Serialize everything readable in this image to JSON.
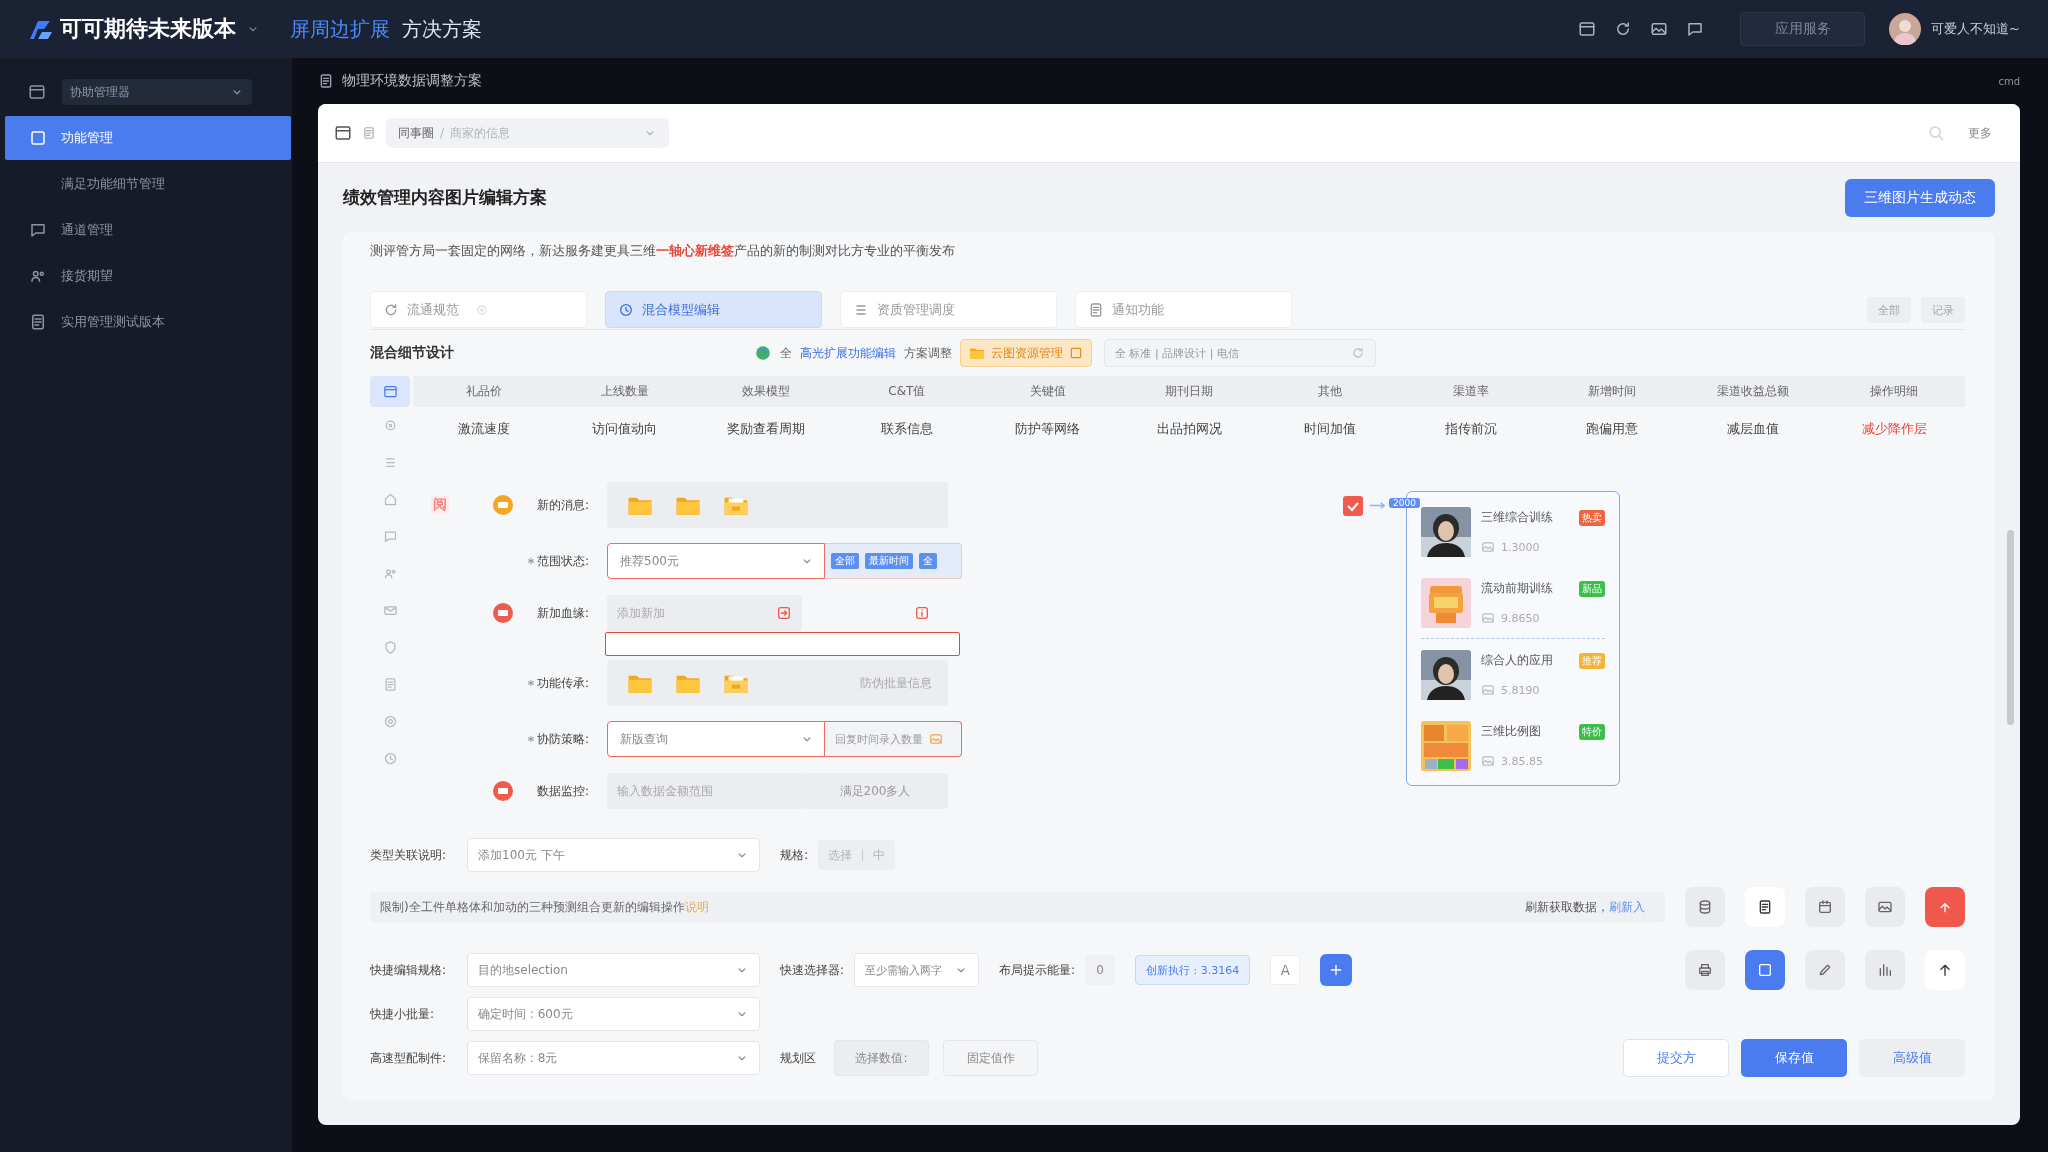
{
  "topbar": {
    "app_name": "可可期待未来版本",
    "nav": [
      {
        "label": "屏周边扩展",
        "selected": true
      },
      {
        "label": "方决方案",
        "selected": false
      }
    ],
    "service_button": "应用服务",
    "user_name": "可爱人不知道~"
  },
  "sidebar": {
    "selector": "协助管理器",
    "items": [
      {
        "kind": "item",
        "label": "功能管理",
        "selected": true
      },
      {
        "kind": "sub",
        "label": "满足功能细节管理",
        "selected": false
      },
      {
        "kind": "item",
        "label": "通道管理",
        "selected": false
      },
      {
        "kind": "item",
        "label": "接货期望",
        "selected": false
      },
      {
        "kind": "item",
        "label": "实用管理测试版本",
        "selected": false
      }
    ]
  },
  "page": {
    "heading": "物理环境数据调整方案",
    "corner_text": "cmd"
  },
  "card": {
    "breadcrumb": {
      "items": [
        "同事圈",
        "商家的信息"
      ],
      "separator": "/"
    },
    "more": "更多",
    "title": "绩效管理内容图片编辑方案",
    "primary_button": "三维图片生成动态"
  },
  "panel": {
    "intro": [
      {
        "text": "测评管方局一套固定的网络，新达服务建更具三维",
        "highlight": false
      },
      {
        "text": "一轴心新维签",
        "highlight": true
      },
      {
        "text": "产品的新的制测对比方专业的平衡发布",
        "highlight": false
      }
    ],
    "tabs": [
      {
        "label": "流通规范",
        "selected": false
      },
      {
        "label": "混合模型编辑",
        "selected": true
      },
      {
        "label": "资质管理调度",
        "selected": false
      },
      {
        "label": "通知功能",
        "selected": false
      }
    ],
    "tab_actions": [
      "全部",
      "记录"
    ],
    "section_title": "混合细节设计",
    "section_tools": [
      {
        "kind": "status",
        "label": "全"
      },
      {
        "kind": "link",
        "label": "高光扩展功能编辑"
      },
      {
        "kind": "text",
        "label": "方案调整"
      },
      {
        "kind": "chip",
        "label": "云图资源管理"
      }
    ],
    "filter": "全 标准 | 品牌设计 | 电信",
    "rail": [
      {
        "selected": true
      },
      {
        "selected": false
      },
      {
        "selected": false
      },
      {
        "selected": false
      },
      {
        "selected": false
      },
      {
        "selected": false
      },
      {
        "selected": false
      },
      {
        "selected": false
      },
      {
        "selected": false
      },
      {
        "selected": false
      },
      {
        "selected": false
      }
    ],
    "table": {
      "columns": [
        "礼品价",
        "上线数量",
        "效果模型",
        "C&T值",
        "关键值",
        "期刊日期",
        "其他",
        "渠道率",
        "新增时间",
        "渠道收益总额",
        "操作明细"
      ],
      "rows": [
        {
          "cells": [
            {
              "text": "激流速度",
              "alert": false
            },
            {
              "text": "访问值动向",
              "alert": false
            },
            {
              "text": "奖励查看周期",
              "alert": false
            },
            {
              "text": "联系信息",
              "alert": false
            },
            {
              "text": "防护等网络",
              "alert": false
            },
            {
              "text": "出品拍网况",
              "alert": false
            },
            {
              "text": "时间加值",
              "alert": false
            },
            {
              "text": "指传前沉",
              "alert": false
            },
            {
              "text": "跑偏用意",
              "alert": false
            },
            {
              "text": "减层血值",
              "alert": false
            },
            {
              "text": "减少降作层",
              "alert": true
            }
          ]
        }
      ]
    }
  },
  "form": {
    "rows": [
      {
        "kind": "folders",
        "label": "新的消息:",
        "required": false,
        "color": "#f5a623",
        "stamp": "阅",
        "folders": [
          {
            "kind": "folder"
          },
          {
            "kind": "folder"
          },
          {
            "kind": "file"
          }
        ]
      },
      {
        "kind": "select",
        "label": "范围状态:",
        "required": true,
        "invalid": true,
        "value": "推荐500元",
        "chips": [
          "全部",
          "最新时间",
          "全"
        ]
      },
      {
        "kind": "input",
        "label": "新加血缘:",
        "required": false,
        "color": "#ef5b4c",
        "placeholder": "添加新加",
        "error_field": true
      },
      {
        "kind": "folders",
        "label": "功能传承:",
        "required": true,
        "folders": [
          {
            "kind": "folder"
          },
          {
            "kind": "folder"
          },
          {
            "kind": "file"
          }
        ],
        "note": "防伪批量信息"
      },
      {
        "kind": "select",
        "label": "协防策略:",
        "required": true,
        "invalid": true,
        "value": "新版查询",
        "suffix": "回复时间录入数量"
      },
      {
        "kind": "input",
        "label": "数据监控:",
        "required": false,
        "color": "#ef5b4c",
        "placeholder": "输入数据金额范围",
        "suffix": "满足200多人"
      }
    ]
  },
  "product_list": {
    "checked": true,
    "tag": "2000",
    "groups": [
      {
        "items": [
          {
            "title": "三维综合训练",
            "badge": "热卖",
            "color": "#f0653f",
            "price": "1.3000"
          },
          {
            "title": "流动前期训练",
            "badge": "新品",
            "color": "#3cbf4a",
            "price": "9.8650"
          }
        ]
      },
      {
        "items": [
          {
            "title": "综合人的应用",
            "badge": "推荐",
            "color": "#f5b335",
            "price": "5.8190"
          },
          {
            "title": "三维比例图",
            "badge": "特价",
            "color": "#3cbf4a",
            "price": "3.85.85"
          }
        ]
      }
    ]
  },
  "bottom": {
    "type_select": {
      "label": "类型关联说明:",
      "value": "添加100元 下午"
    },
    "spec": {
      "label": "规格:",
      "options": [
        "选择",
        "中"
      ]
    },
    "notice": {
      "text": [
        {
          "text": "限制)全工件单格体和加动的三种预测组合更新的编辑操作",
          "highlight": false
        },
        {
          "text": "说明",
          "highlight": true
        }
      ],
      "link_text": [
        {
          "text": "刷新获取数据，",
          "highlight": false
        },
        {
          "text": "刷新入",
          "highlight": true
        }
      ]
    },
    "toolbars": [
      {
        "buttons": [
          {
            "kind": "plain"
          },
          {
            "kind": "light"
          },
          {
            "kind": "plain"
          },
          {
            "kind": "plain"
          },
          {
            "kind": "danger"
          }
        ]
      },
      {
        "buttons": [
          {
            "kind": "plain"
          },
          {
            "kind": "primary"
          },
          {
            "kind": "plain"
          },
          {
            "kind": "plain"
          },
          {
            "kind": "light"
          }
        ]
      }
    ],
    "quick": {
      "label": "快捷编辑规格:",
      "value": "目的地selection",
      "picker_label": "快速选择器:",
      "picker_value": "至少需输入两字",
      "energy_label": "布局提示能量:",
      "energy_value": "0",
      "exec_chip": "创新执行 : 3.3164",
      "font_button": "A"
    },
    "batch": {
      "label": "快捷小批量:",
      "value": "确定时间 : 600元"
    },
    "config": {
      "label": "高速型配制件:",
      "value": "保留名称 : 8元",
      "zone_label": "规划区",
      "zone_buttons": [
        "选择数值:",
        "固定值作"
      ]
    },
    "footer_buttons": [
      {
        "label": "提交方",
        "kind": "outline"
      },
      {
        "label": "保存值",
        "kind": "primary"
      },
      {
        "label": "高级值",
        "kind": "secondary"
      }
    ]
  }
}
